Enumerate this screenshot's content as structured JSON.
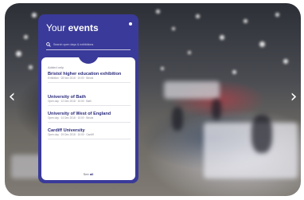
{
  "panel": {
    "title_prefix": "Your",
    "title_strong": "events",
    "close_icon": "dot-icon",
    "search_placeholder": "Search open days & exhibitions",
    "list_heading": "Added only",
    "events": [
      {
        "name": "Bristol higher education exhibition",
        "detail": "Exhibition · 28 Nov 2018 · 10:00 · Bristol"
      },
      {
        "name": "University of Bath",
        "detail": "Open day · 12 Dec 2018 · 10:00 · Bath"
      },
      {
        "name": "University of West of England",
        "detail": "Open day · 14 Dec 2018 · 10:00 · Bristol"
      },
      {
        "name": "Cardiff University",
        "detail": "Open day · 19 Dec 2018 · 10:00 · Cardiff"
      }
    ],
    "see_all_prefix": "See",
    "see_all_strong": "all"
  },
  "nav": {
    "prev_icon": "chevron-left-icon",
    "next_icon": "chevron-right-icon"
  },
  "colors": {
    "panel": "#3a3a9a",
    "accent_text": "#2a2a7a"
  }
}
